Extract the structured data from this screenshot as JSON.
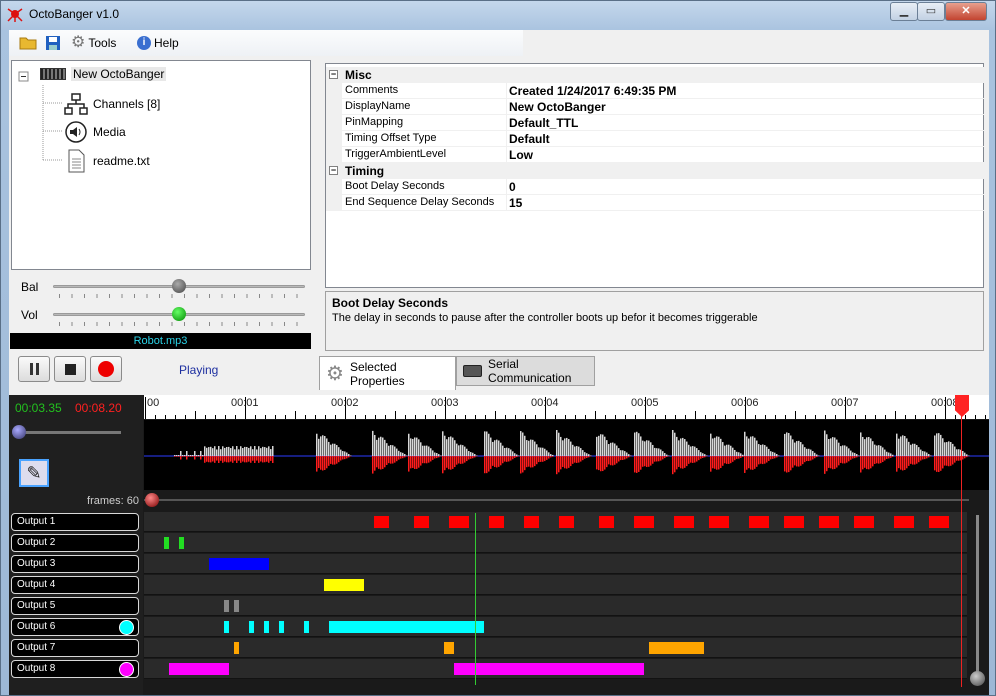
{
  "window": {
    "title": "OctoBanger v1.0",
    "buttons": {
      "minimize": "▁",
      "maximize": "▭",
      "close": "✕"
    }
  },
  "menu": {
    "tools": "Tools",
    "help": "Help"
  },
  "tree": {
    "root": "New OctoBanger",
    "children": [
      "Channels [8]",
      "Media",
      "readme.txt"
    ]
  },
  "sliders": {
    "balance": {
      "label": "Bal",
      "level": 0.5
    },
    "volume": {
      "label": "Vol",
      "level": 0.5
    }
  },
  "player": {
    "file": "Robot.mp3",
    "status": "Playing"
  },
  "properties": [
    {
      "type": "category",
      "name": "Misc"
    },
    {
      "type": "prop",
      "name": "Comments",
      "value": "Created 1/24/2017 6:49:35 PM"
    },
    {
      "type": "prop",
      "name": "DisplayName",
      "value": "New OctoBanger"
    },
    {
      "type": "prop",
      "name": "PinMapping",
      "value": "Default_TTL"
    },
    {
      "type": "prop",
      "name": "Timing Offset Type",
      "value": "Default"
    },
    {
      "type": "prop",
      "name": "TriggerAmbientLevel",
      "value": "Low"
    },
    {
      "type": "category",
      "name": "Timing"
    },
    {
      "type": "prop",
      "name": "Boot Delay Seconds",
      "value": "0"
    },
    {
      "type": "prop",
      "name": "End Sequence Delay Seconds",
      "value": "15"
    }
  ],
  "help": {
    "title": "Boot Delay Seconds",
    "description": "The delay in seconds to pause after the controller boots up befor it becomes triggerable"
  },
  "tabs": [
    {
      "label": "Selected Properties"
    },
    {
      "label": "Serial Communication"
    }
  ],
  "timeline": {
    "current_time": "00:03.35",
    "total_time": "00:08.20",
    "frames_label": "frames: 60",
    "ruler_labels": [
      "00",
      "00:01",
      "00:02",
      "00:03",
      "00:04",
      "00:05",
      "00:06",
      "00:07",
      "00:08"
    ],
    "outputs": [
      {
        "label": "Output 1",
        "color": "#ff0000"
      },
      {
        "label": "Output 2",
        "color": "#22dd22"
      },
      {
        "label": "Output 3",
        "color": "#0000ff"
      },
      {
        "label": "Output 4",
        "color": "#ffff00"
      },
      {
        "label": "Output 5",
        "color": "#888888"
      },
      {
        "label": "Output 6",
        "color": "#00ffff",
        "dot": "#00ffff"
      },
      {
        "label": "Output 7",
        "color": "#ffa500"
      },
      {
        "label": "Output 8",
        "color": "#ff00ff",
        "dot": "#ff00ff"
      }
    ]
  }
}
